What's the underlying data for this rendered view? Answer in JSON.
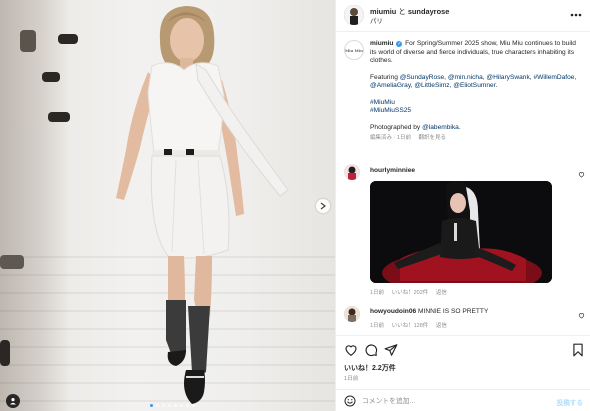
{
  "header": {
    "author": "miumiu",
    "conjunction": "と",
    "coauthor": "sundayrose",
    "location": "パリ",
    "more_icon": "more-horizontal-icon"
  },
  "caption": {
    "author": "miumiu",
    "avatar_text": "Miu Miu",
    "text": "For Spring/Summer 2025 show, Miu Miu continues to build its world of diverse and fierce individuals, true characters inhabiting its clothes.",
    "featuring_label": "Featuring",
    "featuring_links": [
      "@SundayRose",
      "@min.nicha",
      "@HilarySwank",
      "#WillemDafoe",
      "@AmeliaGray",
      "@LittleSimz",
      "@EliotSumner"
    ],
    "hashtags": [
      "#MiuMiu",
      "#MiuMiuSS25"
    ],
    "photographed_by": "Photographed by",
    "photographer": "@labembika",
    "meta_edited": "編集済み · 1日前",
    "meta_translate": "翻訳を見る"
  },
  "comments": [
    {
      "user": "hourlyminniee",
      "time": "1日前",
      "likes": "いいね！202件",
      "reply": "返信"
    },
    {
      "user": "howyoudoin06",
      "text": "MINNIE IS SO PRETTY",
      "time": "1日前",
      "likes": "いいね！128件",
      "reply": "返信"
    }
  ],
  "actions": {
    "likes": "いいね！2.2万件",
    "time": "1日前"
  },
  "composer": {
    "placeholder": "コメントを追加...",
    "post_label": "投稿する"
  },
  "colors": {
    "link": "#00376b",
    "verified": "#3897f0",
    "post_disabled": "#b2dffc",
    "gif_red": "#8a0f1a"
  },
  "carousel": {
    "slides": 8,
    "active": 1
  }
}
